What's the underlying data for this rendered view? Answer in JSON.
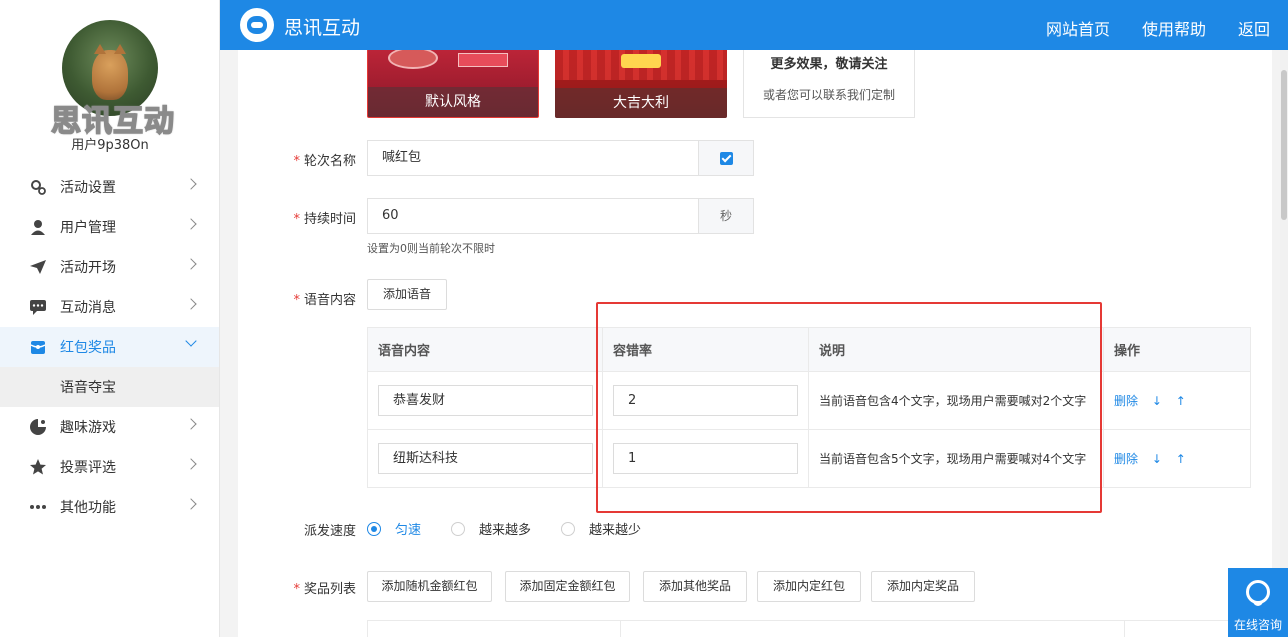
{
  "user": {
    "name": "用户9p38On",
    "brand_watermark": "思讯互动"
  },
  "header": {
    "title": "思讯互动",
    "nav": [
      "网站首页",
      "使用帮助",
      "返回"
    ]
  },
  "sidebar": {
    "items": [
      {
        "label": "活动设置",
        "icon": "gear-icon"
      },
      {
        "label": "用户管理",
        "icon": "user-icon"
      },
      {
        "label": "活动开场",
        "icon": "send-icon"
      },
      {
        "label": "互动消息",
        "icon": "chat-icon"
      },
      {
        "label": "红包奖品",
        "icon": "gift-icon",
        "active": true
      },
      {
        "label": "趣味游戏",
        "icon": "game-icon"
      },
      {
        "label": "投票评选",
        "icon": "star-icon"
      },
      {
        "label": "其他功能",
        "icon": "more-icon"
      }
    ],
    "submenu": {
      "label": "语音夺宝"
    }
  },
  "templates": [
    {
      "label": "默认风格"
    },
    {
      "label": "大吉大利"
    }
  ],
  "more_templates": {
    "line1": "更多效果，敬请关注",
    "line2": "或者您可以联系我们定制"
  },
  "form": {
    "round_name": {
      "label": "轮次名称",
      "value": "喊红包"
    },
    "duration": {
      "label": "持续时间",
      "value": "60",
      "unit": "秒",
      "hint": "设置为0则当前轮次不限时"
    },
    "voice": {
      "label": "语音内容",
      "add_button": "添加语音"
    },
    "speed": {
      "label": "派发速度",
      "options": [
        "匀速",
        "越来越多",
        "越来越少"
      ],
      "selected": 0
    },
    "prizes": {
      "label": "奖品列表",
      "buttons": [
        "添加随机金额红包",
        "添加固定金额红包",
        "添加其他奖品",
        "添加内定红包",
        "添加内定奖品"
      ]
    }
  },
  "voice_table": {
    "headers": [
      "语音内容",
      "容错率",
      "说明",
      "操作"
    ],
    "rows": [
      {
        "content": "恭喜发财",
        "tolerance": "2",
        "note": "当前语音包含4个文字，现场用户需要喊对2个文字",
        "delete": "删除",
        "down": "↓",
        "up": "↑"
      },
      {
        "content": "纽斯达科技",
        "tolerance": "1",
        "note": "当前语音包含5个文字，现场用户需要喊对4个文字",
        "delete": "删除",
        "down": "↓",
        "up": "↑"
      }
    ]
  },
  "consult": {
    "label": "在线咨询"
  }
}
